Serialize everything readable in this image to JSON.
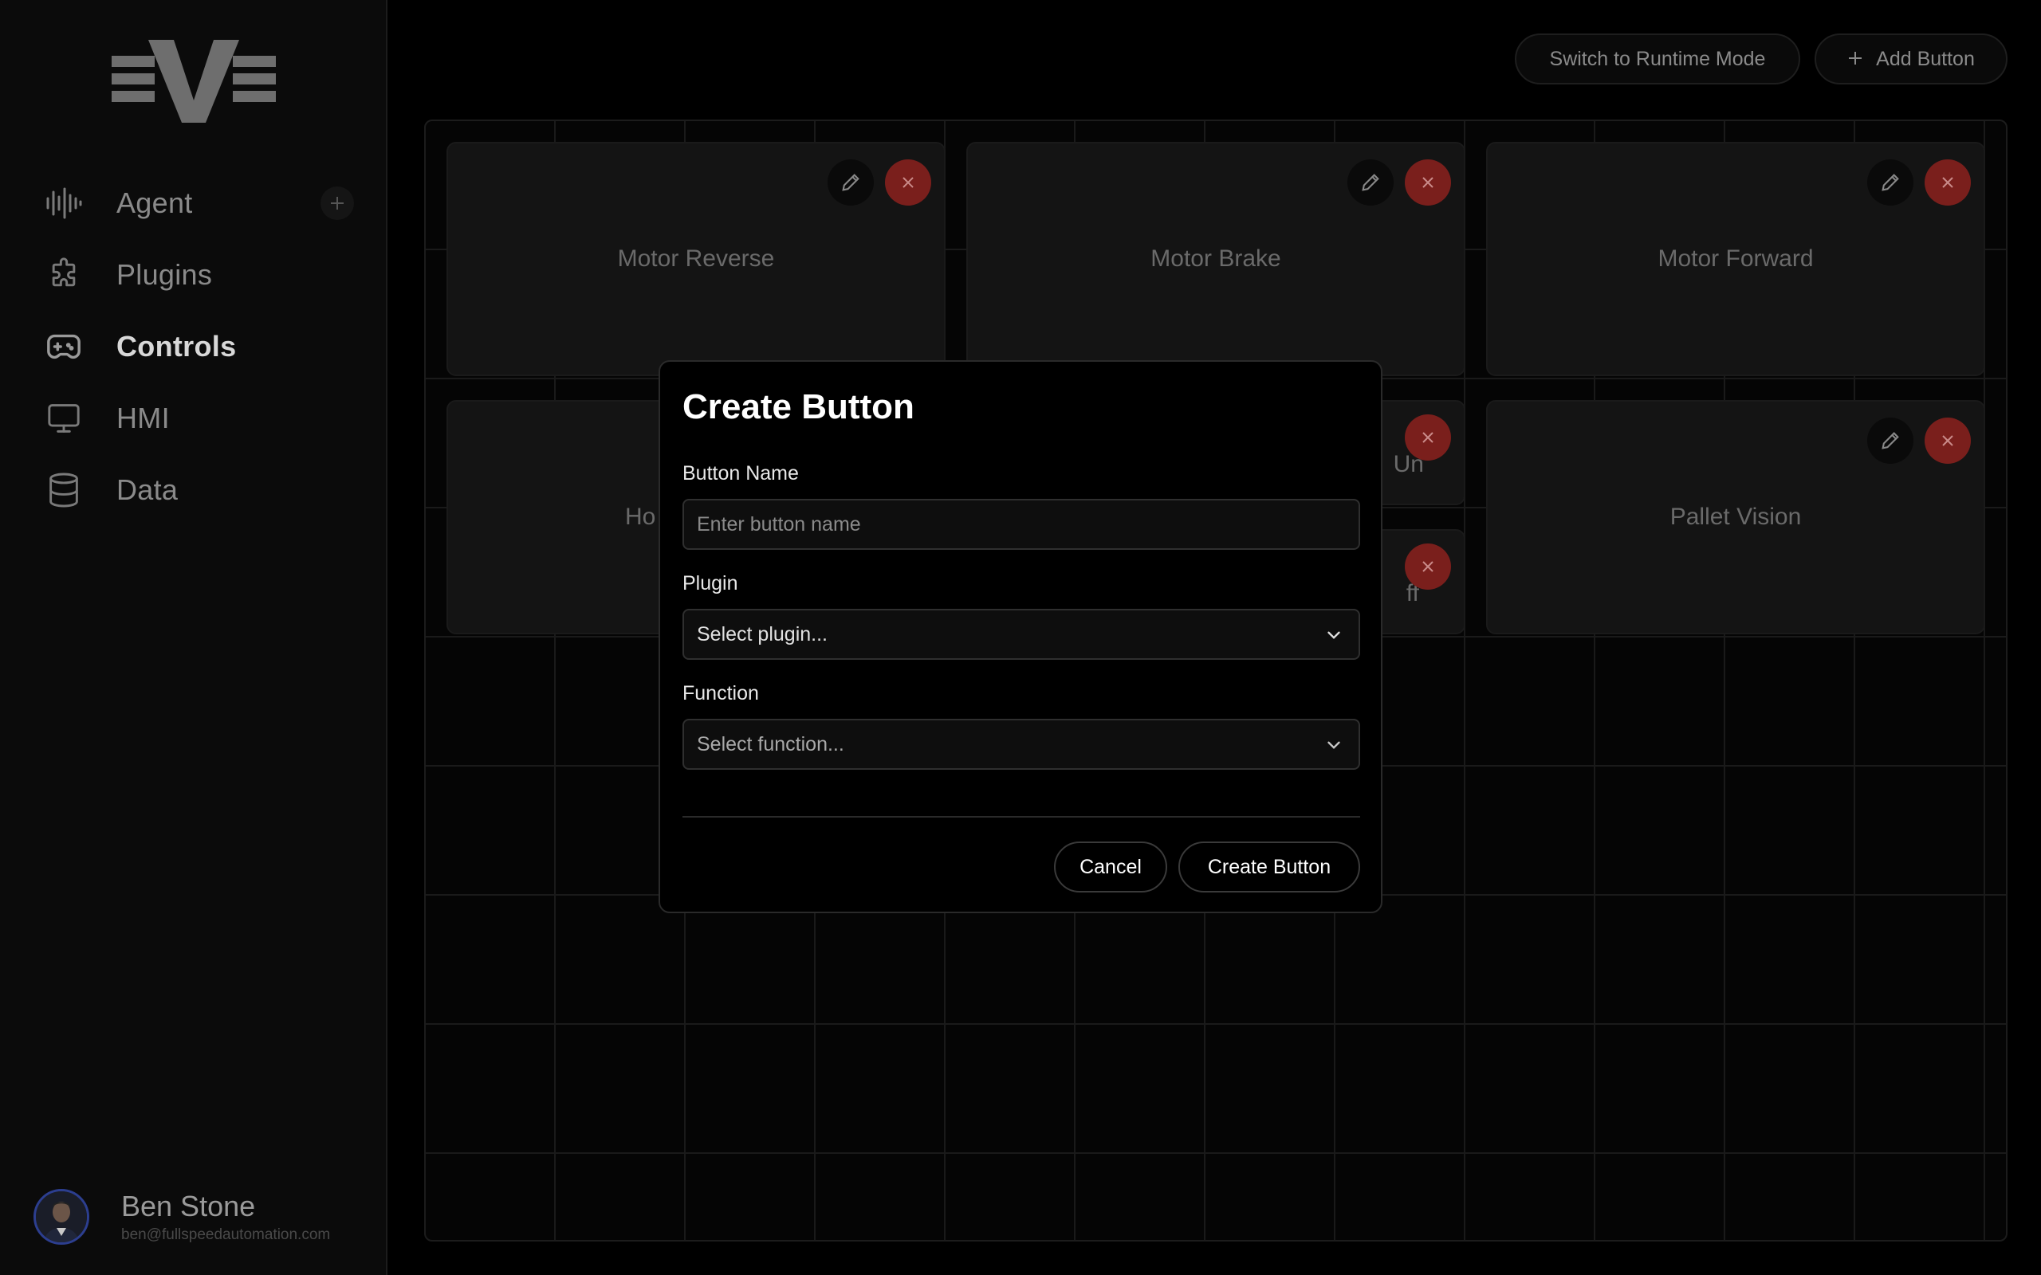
{
  "sidebar": {
    "items": [
      {
        "label": "Agent",
        "icon": "waveform-icon"
      },
      {
        "label": "Plugins",
        "icon": "puzzle-icon"
      },
      {
        "label": "Controls",
        "icon": "gamepad-icon"
      },
      {
        "label": "HMI",
        "icon": "monitor-icon"
      },
      {
        "label": "Data",
        "icon": "database-icon"
      }
    ],
    "active": "Controls",
    "user": {
      "name": "Ben Stone",
      "email": "ben@fullspeedautomation.com"
    }
  },
  "toolbar": {
    "runtime_label": "Switch to Runtime Mode",
    "add_label": "Add Button"
  },
  "cards": [
    {
      "label": "Motor Reverse"
    },
    {
      "label": "Motor Brake"
    },
    {
      "label": "Motor Forward"
    },
    {
      "label": "Ho"
    },
    {
      "label": "Un"
    },
    {
      "label": "ff"
    },
    {
      "label": "Pallet Vision"
    }
  ],
  "modal": {
    "title": "Create Button",
    "name_label": "Button Name",
    "name_placeholder": "Enter button name",
    "plugin_label": "Plugin",
    "plugin_value": "Select plugin...",
    "function_label": "Function",
    "function_value": "Select function...",
    "cancel_label": "Cancel",
    "create_label": "Create Button"
  },
  "colors": {
    "background": "#000000",
    "sidebar": "#0b0b0b",
    "delete": "#7a1f1c",
    "modal_border": "#2a2a2a"
  }
}
